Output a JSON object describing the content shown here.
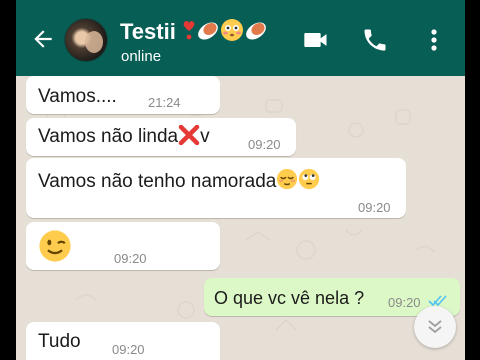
{
  "header": {
    "contact_name": "Testii",
    "status": "online",
    "colors": {
      "bar": "#075e54",
      "icons": "#ffffff"
    },
    "icons": [
      "back-arrow-icon",
      "video-call-icon",
      "phone-call-icon",
      "more-options-icon"
    ],
    "name_emojis": [
      "heart-exclamation",
      "rugby-ball",
      "flushed-face",
      "rugby-ball"
    ]
  },
  "messages": [
    {
      "direction": "incoming",
      "text": "Vamos....",
      "time": "21:24"
    },
    {
      "direction": "incoming",
      "text": "Vamos não linda",
      "suffix": "v",
      "time": "09:20",
      "emojis": [
        "cross-mark"
      ]
    },
    {
      "direction": "incoming",
      "text": "Vamos não tenho namorada",
      "time": "09:20",
      "emojis": [
        "relieved-face",
        "eye-roll-face"
      ]
    },
    {
      "direction": "incoming",
      "text": "",
      "time": "09:20",
      "emojis": [
        "winking-face"
      ]
    },
    {
      "direction": "outgoing",
      "text": "O que vc vê nela ?",
      "time": "09:20",
      "ticks": "double-blue"
    },
    {
      "direction": "incoming",
      "text": "Tudo",
      "time": "09:20"
    }
  ],
  "colors": {
    "chat_background": "#e6dfd6",
    "incoming_bubble": "#ffffff",
    "outgoing_bubble": "#dcf8c6",
    "read_ticks": "#4fc3f7"
  }
}
